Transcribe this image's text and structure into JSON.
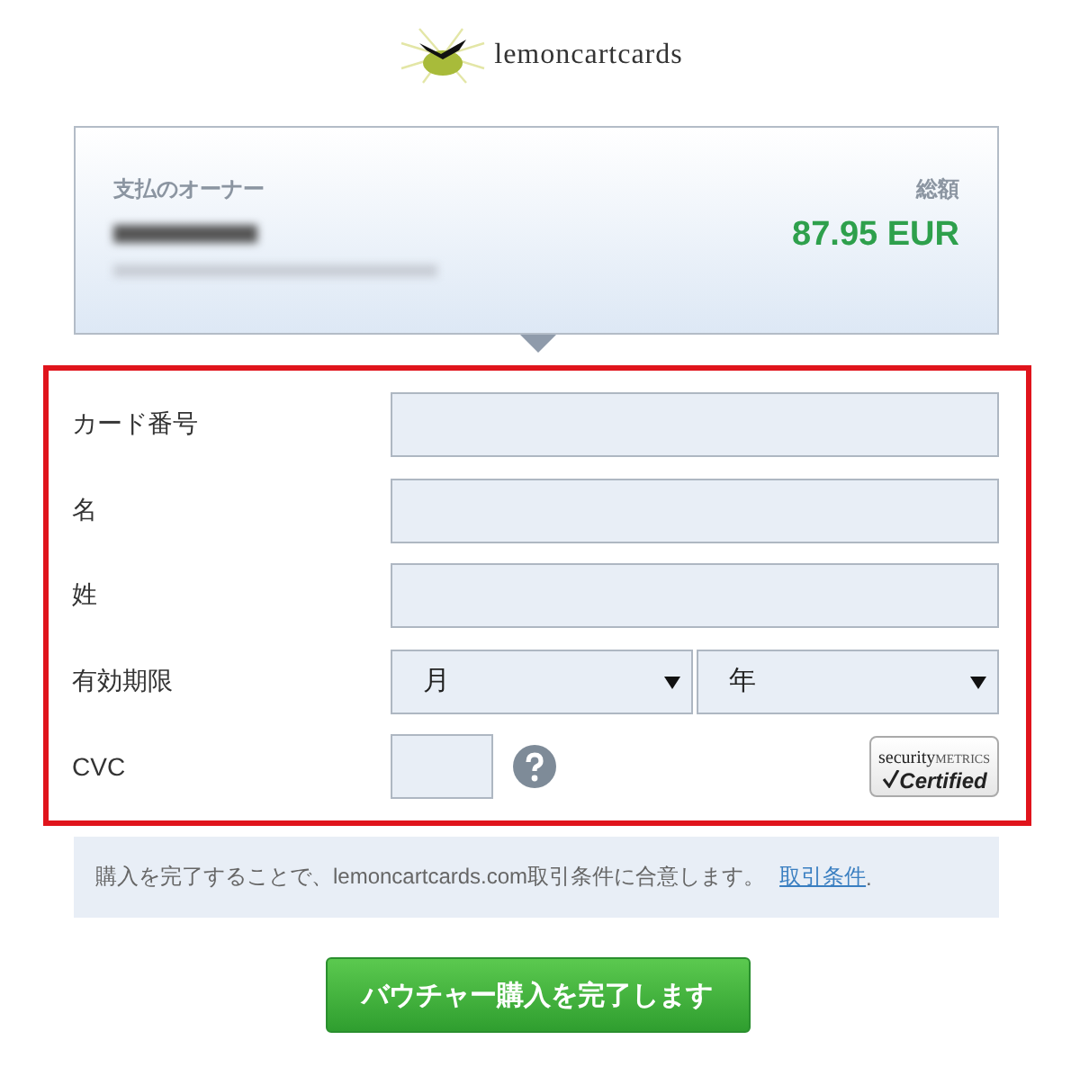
{
  "logo": {
    "text": "lemoncartcards"
  },
  "payer": {
    "owner_label": "支払のオーナー",
    "total_label": "総額",
    "total": "87.95 EUR"
  },
  "form": {
    "highlighted": true,
    "rows": [
      {
        "kind": "text",
        "label": "カード番号"
      },
      {
        "kind": "text",
        "label": "名"
      },
      {
        "kind": "text",
        "label": "姓"
      },
      {
        "kind": "selects",
        "label": "有効期限",
        "selects": [
          {
            "value": "月"
          },
          {
            "value": "年"
          }
        ]
      },
      {
        "kind": "cvc",
        "label": "CVC",
        "badge": {
          "word": "security",
          "brand": "METRICS",
          "status": "Certified"
        }
      }
    ]
  },
  "terms": {
    "text": "購入を完了することで、lemoncartcards.com取引条件に合意します。",
    "link": "取引条件",
    "end": "."
  },
  "submit": {
    "label": "バウチャー購入を完了します"
  }
}
